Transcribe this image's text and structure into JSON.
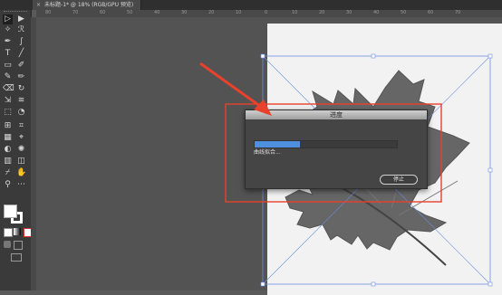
{
  "tabbar": {
    "close_glyph": "×",
    "document_title": "未标题-1* @ 18% (RGB/GPU 预览)"
  },
  "ruler": {
    "top_labels": [
      "80",
      "70",
      "60",
      "50",
      "40",
      "30",
      "20",
      "10",
      "0",
      "10",
      "20",
      "30",
      "40",
      "50",
      "60",
      "70"
    ]
  },
  "dialog": {
    "title": "进度",
    "status": "曲线拟合...",
    "stop_label": "停止",
    "progress_fraction": 0.32,
    "progress_color": "#4e8fe0"
  },
  "annotations": {
    "arrow_color": "#e8412c",
    "highlight_color": "#e8412c"
  },
  "toolbar": {
    "tool_icons": [
      "selection-arrow-icon",
      "direct-selection-icon",
      "magic-wand-icon",
      "lasso-icon",
      "pen-icon",
      "curvature-icon",
      "type-icon",
      "line-icon",
      "rectangle-icon",
      "paintbrush-icon",
      "shaper-icon",
      "pencil-icon",
      "eraser-icon",
      "rotate-icon",
      "scale-icon",
      "warp-icon",
      "free-transform-icon",
      "shape-builder-icon",
      "perspective-grid-icon",
      "mesh-icon",
      "gradient-icon",
      "eyedropper-icon",
      "blend-icon",
      "symbol-sprayer-icon",
      "column-graph-icon",
      "artboard-icon",
      "slice-icon",
      "hand-icon",
      "zoom-icon"
    ]
  }
}
